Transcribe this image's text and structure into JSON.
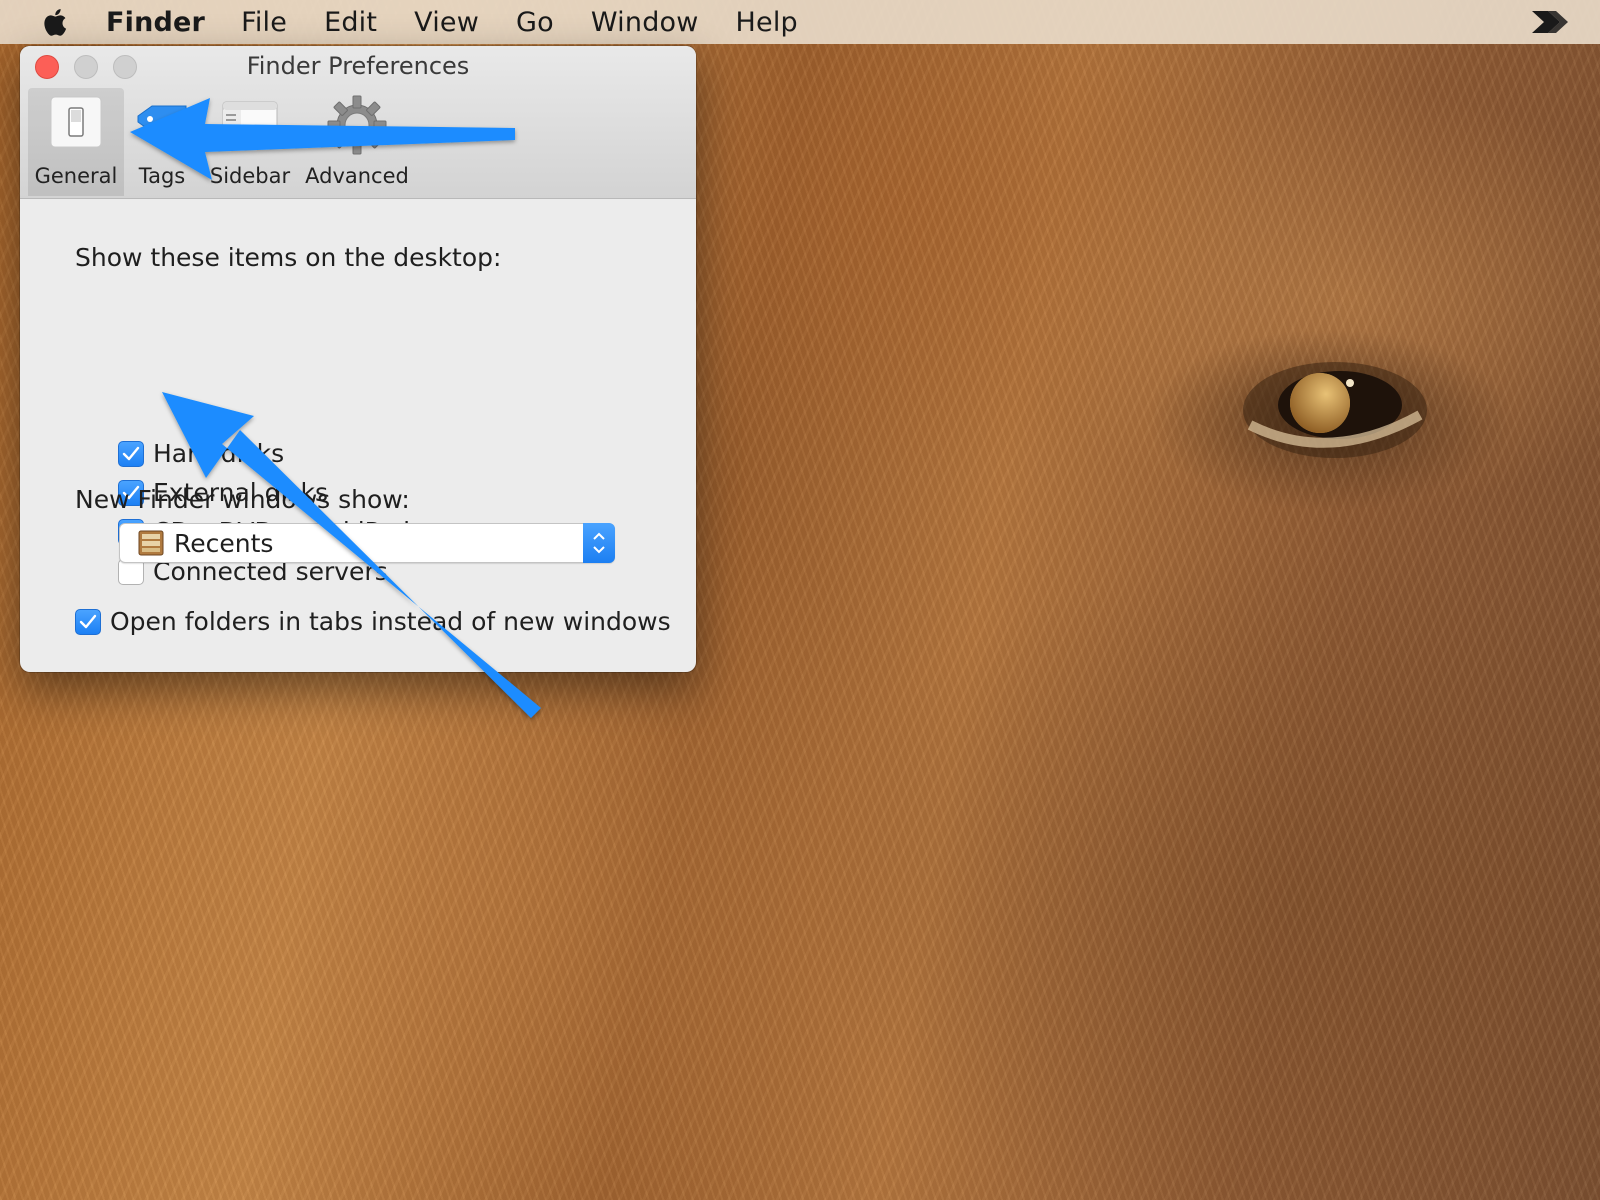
{
  "menubar": {
    "items": [
      {
        "label": "Finder",
        "bold": true
      },
      {
        "label": "File"
      },
      {
        "label": "Edit"
      },
      {
        "label": "View"
      },
      {
        "label": "Go"
      },
      {
        "label": "Window"
      },
      {
        "label": "Help"
      }
    ]
  },
  "window": {
    "title": "Finder Preferences",
    "toolbar": {
      "general": "General",
      "tags": "Tags",
      "sidebar": "Sidebar",
      "advanced": "Advanced",
      "selected": "general"
    },
    "desktop_items_label": "Show these items on the desktop:",
    "desktop_items": [
      {
        "label": "Hard disks",
        "checked": true
      },
      {
        "label": "External disks",
        "checked": true
      },
      {
        "label": "CDs, DVDs, and iPods",
        "checked": true
      },
      {
        "label": "Connected servers",
        "checked": false
      }
    ],
    "new_window_label": "New Finder windows show:",
    "new_window_value": "Recents",
    "open_in_tabs": {
      "label": "Open folders in tabs instead of new windows",
      "checked": true
    }
  },
  "colors": {
    "accent": "#1c80f4",
    "annotation_arrow": "#1a8cff",
    "close_button": "#fc5f57"
  },
  "icons": {
    "menubar_left": "apple-icon",
    "menubar_right": "arrow-extension-icon",
    "general": "light-switch-icon",
    "tags": "tag-icon",
    "sidebar": "sidebar-window-icon",
    "advanced": "gear-icon",
    "recents": "recents-drawer-icon"
  }
}
